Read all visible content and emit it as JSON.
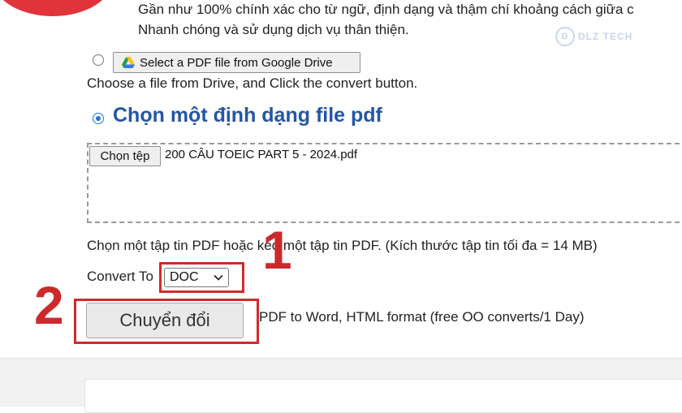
{
  "page": {
    "feature_line_1": "Gần như 100% chính xác cho từ ngữ, định dạng và thậm chí khoảng cách giữa c",
    "feature_line_2": "Nhanh chóng và sử dụng dịch vụ thân thiện."
  },
  "watermark": {
    "mark": "D",
    "text": "DLZ TECH"
  },
  "drive": {
    "button_label": "Select a PDF file from Google Drive",
    "help_text": "Choose a file from Drive, and Click the convert button.",
    "icon": "google-drive-icon",
    "selected": false
  },
  "upload": {
    "heading": "Chọn một định dạng file pdf",
    "selected": true,
    "choose_button_label": "Chọn tệp",
    "file_name": "200 CÂU TOEIC PART 5 - 2024.pdf",
    "helper_text": "Chọn một tập tin PDF hoặc kéo một tập tin PDF. (Kích thước tập tin tối đa = 14 MB)"
  },
  "convert": {
    "label": "Convert To",
    "selected_format": "DOC",
    "button_label": "Chuyển đổi",
    "info_text": "PDF to Word, HTML format (free OO converts/1 Day)"
  },
  "annotations": {
    "step_1": "1",
    "step_2": "2",
    "highlight_color": "#d22a2a"
  },
  "colors": {
    "heading": "#2456a4",
    "radio_accent": "#1a73e8",
    "brand_red": "#e0343a"
  }
}
